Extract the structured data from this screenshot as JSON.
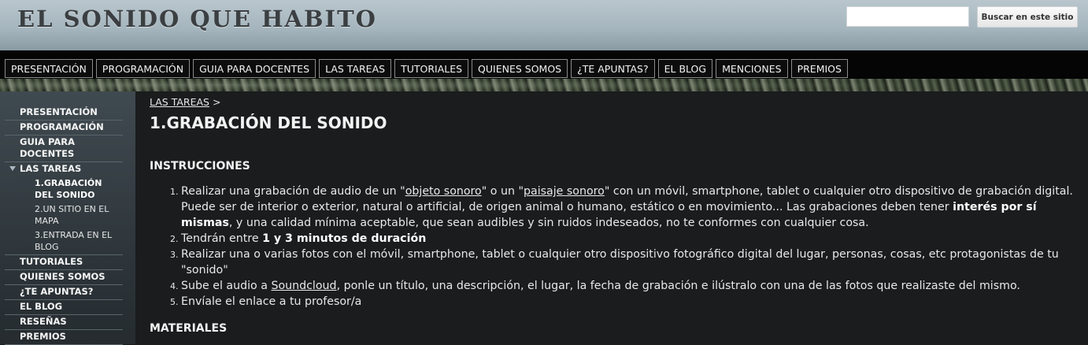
{
  "site": {
    "title": "EL SONIDO QUE HABITO"
  },
  "search": {
    "placeholder": "",
    "button_label": "Buscar en este sitio"
  },
  "nav": {
    "tabs": [
      "PRESENTACIÓN",
      "PROGRAMACIÓN",
      "GUIA PARA DOCENTES",
      "LAS TAREAS",
      "TUTORIALES",
      "QUIENES SOMOS",
      "¿TE APUNTAS?",
      "EL BLOG",
      "MENCIONES",
      "PREMIOS"
    ]
  },
  "sidebar": {
    "items": [
      {
        "label": "PRESENTACIÓN"
      },
      {
        "label": "PROGRAMACIÓN"
      },
      {
        "label": "GUIA PARA DOCENTES"
      },
      {
        "label": "LAS TAREAS",
        "expanded": true
      },
      {
        "label": "TUTORIALES"
      },
      {
        "label": "QUIENES SOMOS"
      },
      {
        "label": "¿TE APUNTAS?"
      },
      {
        "label": "EL BLOG"
      },
      {
        "label": "RESEÑAS"
      },
      {
        "label": "PREMIOS"
      }
    ],
    "subitems": [
      {
        "label": "1.GRABACIÓN DEL SONIDO",
        "active": true
      },
      {
        "label": "2.UN SITIO EN EL MAPA"
      },
      {
        "label": "3.ENTRADA EN EL BLOG"
      }
    ]
  },
  "main": {
    "breadcrumb": {
      "link": "LAS TAREAS",
      "separator": ">"
    },
    "title": "1.GRABACIÓN DEL SONIDO",
    "instructions_heading": "INSTRUCCIONES",
    "instructions": [
      {
        "t1": "Realizar una grabación de audio de un \"",
        "link1": "objeto sonoro",
        "t2": "\" o un \"",
        "link2": "paisaje sonoro",
        "t3": "\" con un móvil, smartphone, tablet o cualquier otro dispositivo de grabación digital. Puede ser de interior o exterior, natural o artificial, de origen animal o humano, estático o en movimiento... Las grabaciones deben tener ",
        "bold": "interés por sí mismas",
        "t4": ", y una calidad mínima aceptable, que sean audibles y sin ruidos indeseados, no te conformes con cualquier cosa."
      },
      {
        "t1": "Tendrán entre ",
        "bold": "1 y 3 minutos de duración"
      },
      {
        "text": "Realizar una o varias fotos con el móvil, smartphone, tablet o cualquier otro dispositivo fotográfico digital del lugar, personas, cosas, etc protagonistas de tu \"sonido\""
      },
      {
        "t1": "Sube el audio a ",
        "link": "Soundcloud",
        "t2": ", ponle un título, una descripción, el lugar, la fecha de grabación e ilústralo con una de las fotos que realizaste del mismo."
      },
      {
        "text": "Envíale el enlace a tu profesor/a"
      }
    ],
    "materials_heading": "MATERIALES"
  }
}
